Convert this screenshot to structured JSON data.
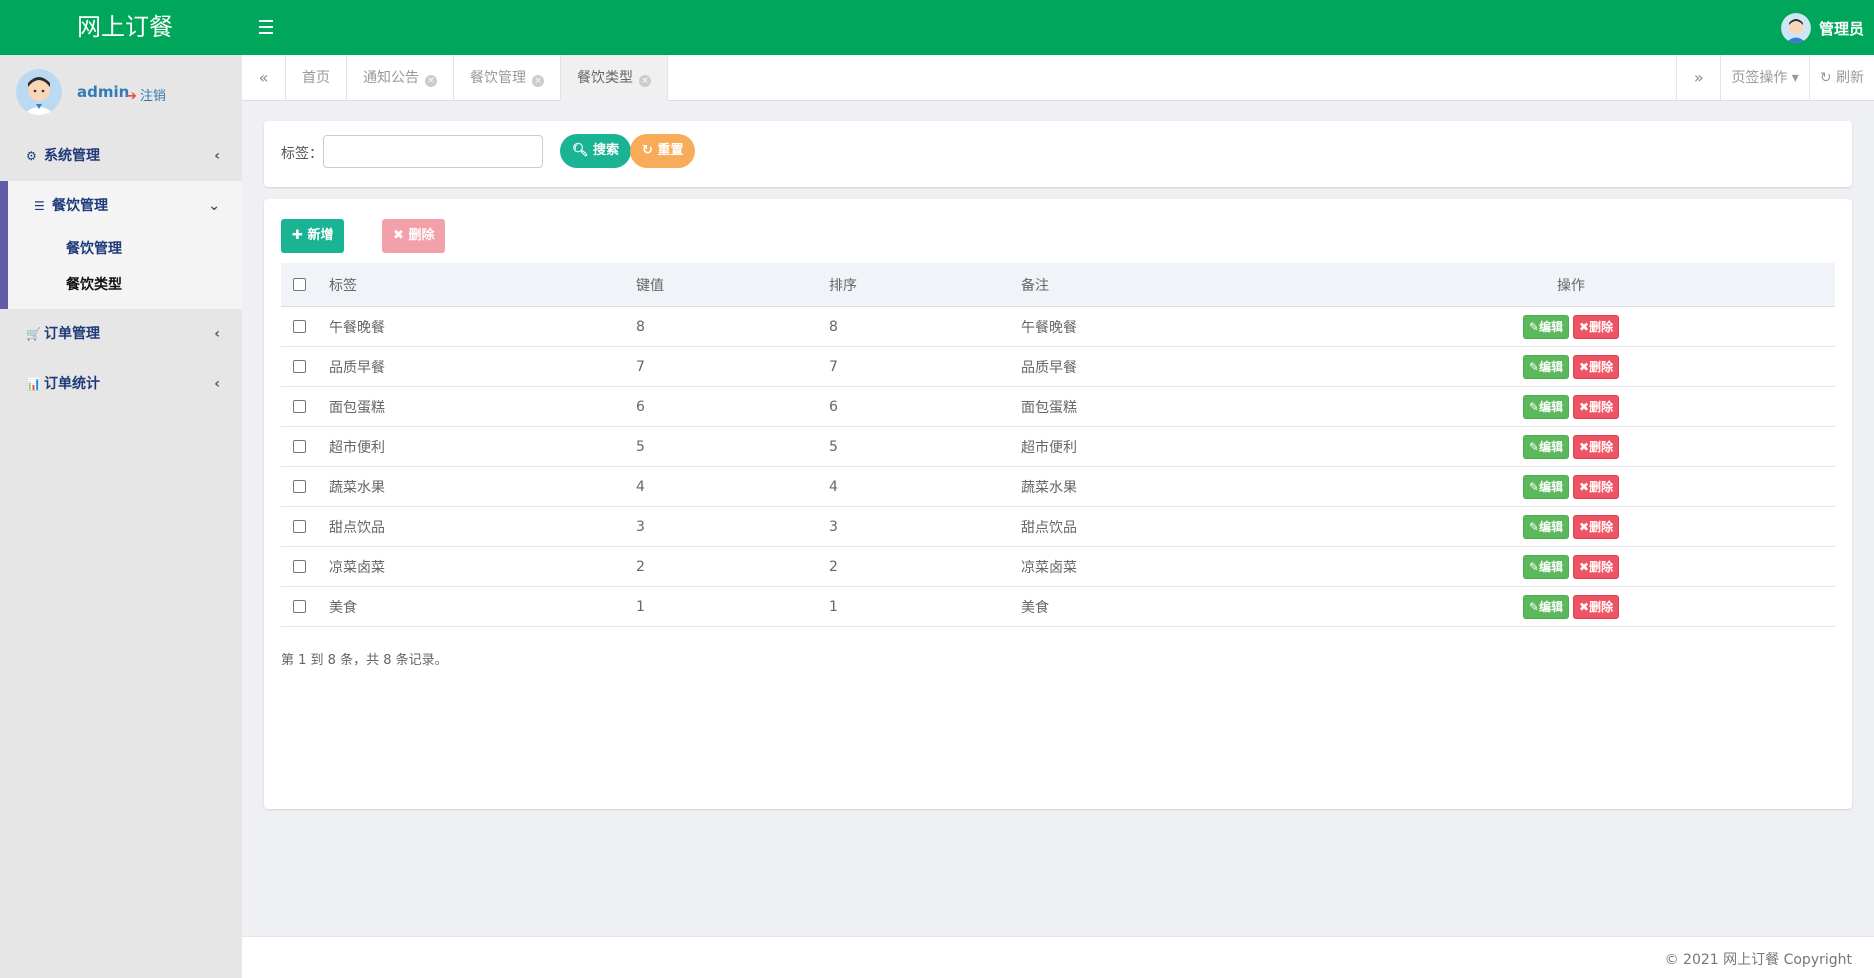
{
  "app": {
    "title": "网上订餐",
    "top_user": "管理员"
  },
  "sidebar": {
    "user": {
      "name": "admin",
      "logout": "注销"
    },
    "menus": [
      {
        "label": "系统管理"
      },
      {
        "label": "餐饮管理",
        "children": [
          {
            "label": "餐饮管理"
          },
          {
            "label": "餐饮类型"
          }
        ]
      },
      {
        "label": "订单管理"
      },
      {
        "label": "订单统计"
      }
    ]
  },
  "tabs": {
    "items": [
      "首页",
      "通知公告",
      "餐饮管理",
      "餐饮类型"
    ],
    "page_ops": "页签操作",
    "refresh": "刷新"
  },
  "search": {
    "label": "标签：",
    "value": "",
    "search_btn": "搜索",
    "reset_btn": "重置"
  },
  "toolbar": {
    "add": "新增",
    "delete": "删除"
  },
  "table": {
    "headers": [
      "标签",
      "键值",
      "排序",
      "备注",
      "操作"
    ],
    "rows": [
      [
        "午餐晚餐",
        "8",
        "8",
        "午餐晚餐"
      ],
      [
        "品质早餐",
        "7",
        "7",
        "品质早餐"
      ],
      [
        "面包蛋糕",
        "6",
        "6",
        "面包蛋糕"
      ],
      [
        "超市便利",
        "5",
        "5",
        "超市便利"
      ],
      [
        "蔬菜水果",
        "4",
        "4",
        "蔬菜水果"
      ],
      [
        "甜点饮品",
        "3",
        "3",
        "甜点饮品"
      ],
      [
        "凉菜卤菜",
        "2",
        "2",
        "凉菜卤菜"
      ],
      [
        "美食",
        "1",
        "1",
        "美食"
      ]
    ],
    "edit_label": "编辑",
    "delete_label": "删除",
    "summary": "第 1 到 8 条，共 8 条记录。"
  },
  "footer": {
    "text": "© 2021 网上订餐 Copyright"
  },
  "colors": {
    "header": "#00a65a",
    "primary": "#1ab394",
    "warning": "#f8ac59",
    "danger": "#ed5565",
    "success": "#5cb85c",
    "menu_accent": "#605ca8"
  }
}
